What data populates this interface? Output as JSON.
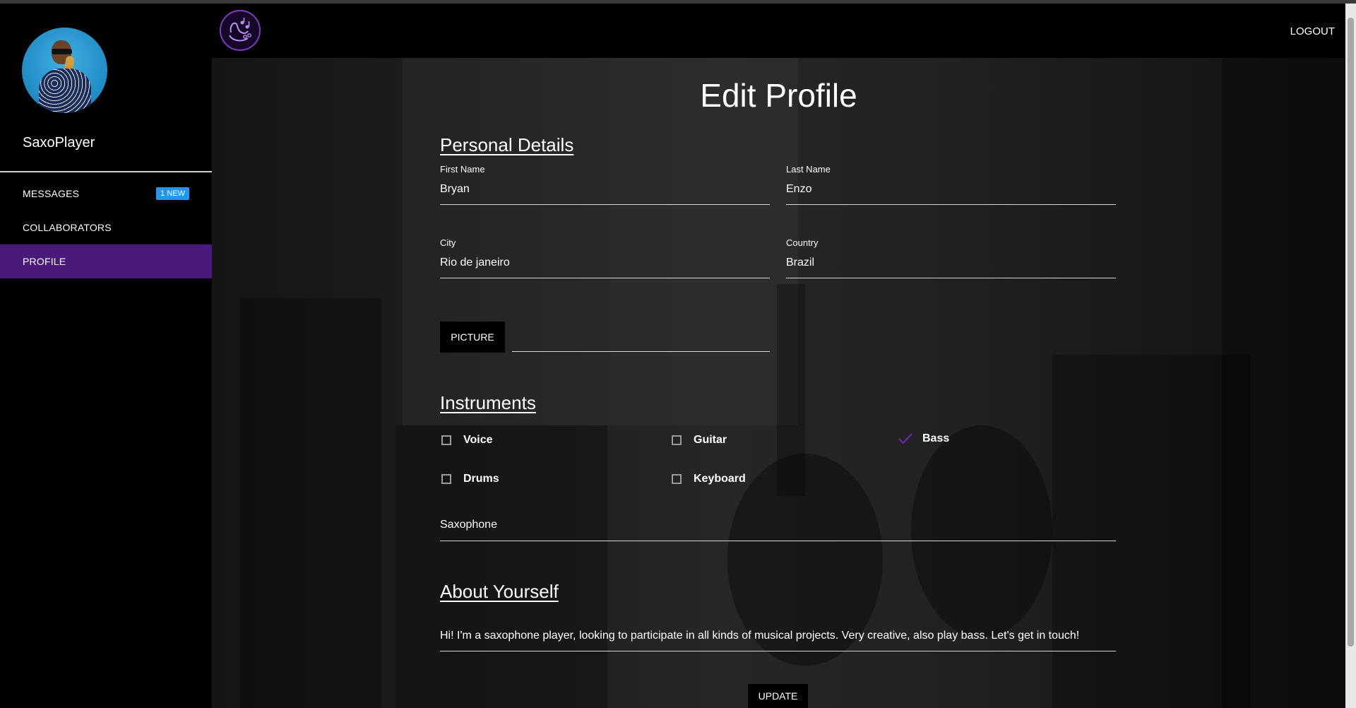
{
  "sidebar": {
    "username": "SaxoPlayer",
    "items": [
      {
        "label": "MESSAGES",
        "badge": "1 NEW"
      },
      {
        "label": "COLLABORATORS"
      },
      {
        "label": "PROFILE"
      }
    ]
  },
  "topbar": {
    "logout_label": "LOGOUT"
  },
  "form": {
    "title": "Edit Profile",
    "personal_details_heading": "Personal Details",
    "first_name": {
      "label": "First Name",
      "value": "Bryan"
    },
    "last_name": {
      "label": "Last Name",
      "value": "Enzo"
    },
    "city": {
      "label": "City",
      "value": "Rio de janeiro"
    },
    "country": {
      "label": "Country",
      "value": "Brazil"
    },
    "picture_label": "PICTURE",
    "instruments_heading": "Instruments",
    "instruments": {
      "voice": {
        "label": "Voice",
        "checked": false
      },
      "guitar": {
        "label": "Guitar",
        "checked": false
      },
      "bass": {
        "label": "Bass",
        "checked": true
      },
      "drums": {
        "label": "Drums",
        "checked": false
      },
      "keyboard": {
        "label": "Keyboard",
        "checked": false
      }
    },
    "other_instrument": "Saxophone",
    "about_heading": "About Yourself",
    "about_text": "Hi! I'm a saxophone player, looking to participate in all kinds of musical projects. Very creative, also play bass. Let's get in touch!",
    "update_label": "UPDATE"
  },
  "colors": {
    "accent": "#4a1a7a",
    "badge": "#2196f3",
    "check": "#5b2a9e"
  }
}
